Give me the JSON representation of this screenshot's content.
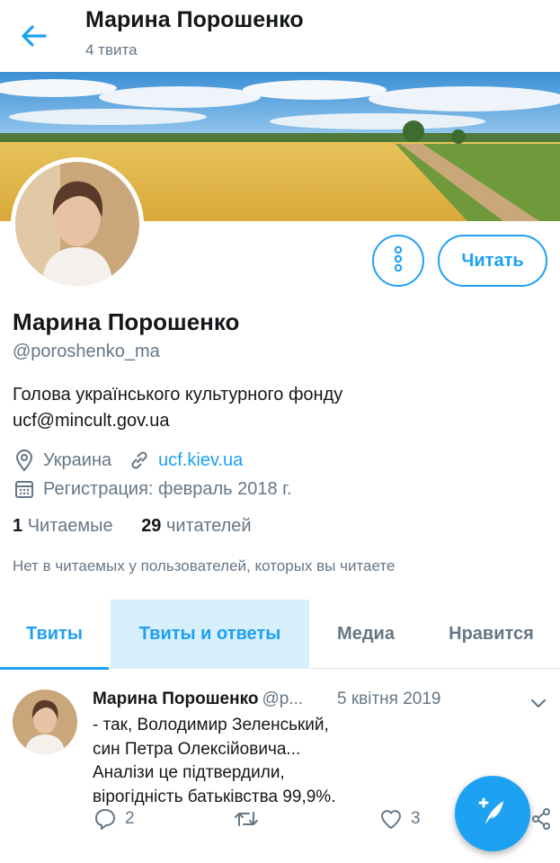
{
  "header": {
    "title": "Марина Порошенко",
    "tweet_count": "4 твита"
  },
  "profile": {
    "name": "Марина Порошенко",
    "handle": "@poroshenko_ma",
    "bio_line1": "Голова українського культурного фонду",
    "bio_line2": "ucf@mincult.gov.ua",
    "location": "Украина",
    "website": "ucf.kiev.ua",
    "joined": "Регистрация: февраль 2018 г.",
    "following_count": "1",
    "following_label": "Читаемые",
    "followers_count": "29",
    "followers_label": "читателей",
    "mutual_notice": "Нет в читаемых у пользователей, которых вы читаете",
    "follow_button": "Читать"
  },
  "tabs": [
    {
      "label": "Твиты",
      "state": "active"
    },
    {
      "label": "Твиты и ответы",
      "state": "hover"
    },
    {
      "label": "Медиа",
      "state": "normal"
    },
    {
      "label": "Нравится",
      "state": "normal"
    }
  ],
  "tweet": {
    "author_name": "Марина Порошенко",
    "author_handle": "@p...",
    "date": "5 квітня 2019",
    "line1": "- так, Володимир Зеленський,",
    "line2": "син Петра Олексійовича...",
    "line3": "Аналізи це підтвердили,",
    "line4": "вірогідність батьківства 99,9%.",
    "replies": "2",
    "retweets": "",
    "likes": "3"
  },
  "icons": {
    "back": "arrow-left-icon",
    "more": "more-vertical-icon",
    "location": "location-pin-icon",
    "link": "link-icon",
    "calendar": "calendar-icon",
    "reply": "reply-icon",
    "retweet": "retweet-icon",
    "like": "heart-icon",
    "share": "share-icon",
    "compose": "compose-tweet-icon",
    "chevron": "chevron-down-icon"
  },
  "colors": {
    "accent": "#1da1f2",
    "text_primary": "#14171a",
    "text_secondary": "#657786",
    "tab_hover_bg": "#d7eefb"
  }
}
